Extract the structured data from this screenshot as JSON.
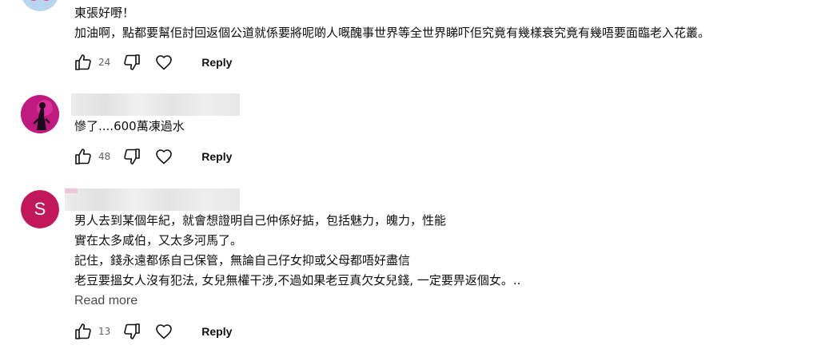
{
  "comments": [
    {
      "lines": [
        "東張好嘢！",
        "加油啊，點都要幫佢討回返個公道就係要將呢啲人嘅醜事世界等全世界睇吓佢究竟有幾樣衰究竟有幾唔要面臨老入花叢。"
      ],
      "likes": "24",
      "reply_label": "Reply",
      "avatar_icon": "avatar-icon"
    },
    {
      "lines": [
        "慘了....600萬凍過水"
      ],
      "likes": "48",
      "reply_label": "Reply",
      "avatar_icon": "spider-avatar-icon"
    },
    {
      "avatar_letter": "S",
      "avatar_color": "#c2185b",
      "lines": [
        "男人去到某個年紀，就會想證明自己仲係好掂，包括魅力，魄力，性能",
        "實在太多咸伯，又太多河馬了。",
        "記住，錢永遠都係自己保管，無論自己仔女抑或父母都唔好盡信",
        "老豆要搵女人沒有犯法, 女兒無權干涉,不過如果老豆真欠女兒錢, 一定要畀返個女。.."
      ],
      "read_more": "Read more",
      "likes": "13",
      "reply_label": "Reply"
    }
  ]
}
